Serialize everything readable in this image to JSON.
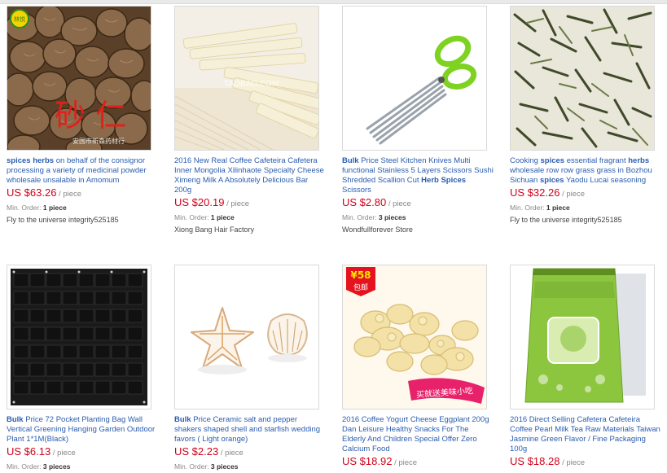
{
  "products": [
    {
      "title_parts": [
        [
          "spices herbs",
          true
        ],
        [
          " on behalf of the consignor processing a variety of medicinal powder wholesale unsalable in Amomum",
          false
        ]
      ],
      "price": "US $63.26",
      "unit": " / piece",
      "min_label": "Min. Order: ",
      "min_value": "1 piece",
      "store": "Fly to the universe integrity525185",
      "image_text": "砂 仁",
      "image_caption": "安国市新森药材行",
      "icon": "amomum-seeds-image"
    },
    {
      "title_parts": [
        [
          "2016 New Real Coffee Cafeteira Cafetera Inner Mongolia Xilinhaote Specialty Cheese Ximeng Milk A Absolutely Delicious Bar 200g",
          false
        ]
      ],
      "price": "US $20.19",
      "unit": " / piece",
      "min_label": "Min. Order: ",
      "min_value": "1 piece",
      "store": "Xiong Bang Hair Factory",
      "image_text": "TAOBAO.COM",
      "icon": "cheese-bars-image"
    },
    {
      "title_parts": [
        [
          "Bulk",
          true
        ],
        [
          " Price Steel Kitchen Knives Multi functional Stainless 5 Layers Scissors Sushi Shredded Scallion Cut ",
          false
        ],
        [
          "Herb Spices",
          true
        ],
        [
          " Scissors",
          false
        ]
      ],
      "price": "US $2.80",
      "unit": " / piece",
      "min_label": "Min. Order: ",
      "min_value": "3 pieces",
      "store": "Wondfullforever Store",
      "icon": "herb-scissors-image"
    },
    {
      "title_parts": [
        [
          "Cooking ",
          false
        ],
        [
          "spices",
          true
        ],
        [
          " essential fragrant ",
          false
        ],
        [
          "herbs",
          true
        ],
        [
          " wholesale row row grass grass in Bozhou Sichuan ",
          false
        ],
        [
          "spices",
          true
        ],
        [
          " Yaodu Lucai seasoning",
          false
        ]
      ],
      "price": "US $32.26",
      "unit": " / piece",
      "min_label": "Min. Order: ",
      "min_value": "1 piece",
      "store": "Fly to the universe integrity525185",
      "icon": "dried-herbs-image"
    },
    {
      "title_parts": [
        [
          "Bulk",
          true
        ],
        [
          " Price 72 Pocket Planting Bag Wall Vertical Greening Hanging Garden Outdoor Plant 1*1M(Black)",
          false
        ]
      ],
      "price": "US $6.13",
      "unit": " / piece",
      "min_label": "Min. Order: ",
      "min_value": "3 pieces",
      "icon": "planting-bag-image"
    },
    {
      "title_parts": [
        [
          "Bulk",
          true
        ],
        [
          " Price Ceramic salt and pepper shakers shaped shell and starfish wedding favors ( Light orange)",
          false
        ]
      ],
      "price": "US $2.23",
      "unit": " / piece",
      "min_label": "Min. Order: ",
      "min_value": "3 pieces",
      "icon": "shell-shakers-image"
    },
    {
      "title_parts": [
        [
          "2016 Coffee Yogurt Cheese Eggplant 200g Dan Leisure Healthy Snacks For The Elderly And Children Special Offer Zero Calcium Food",
          false
        ]
      ],
      "price": "US $18.92",
      "unit": " / piece",
      "image_badge_price": "¥58",
      "image_badge_text": "包邮",
      "image_banner": "买就送美味小吃",
      "icon": "yogurt-cheese-image"
    },
    {
      "title_parts": [
        [
          "2016 Direct Selling Cafetera Cafeteira Coffee Pearl Milk Tea Raw Materials Taiwan Jasmine Green Flavor / Fine Packaging 100g",
          false
        ]
      ],
      "price": "US $18.28",
      "unit": " / piece",
      "icon": "tea-package-image"
    }
  ],
  "colors": {
    "link": "#2a5db0",
    "price": "#d0021b",
    "muted": "#888888"
  }
}
